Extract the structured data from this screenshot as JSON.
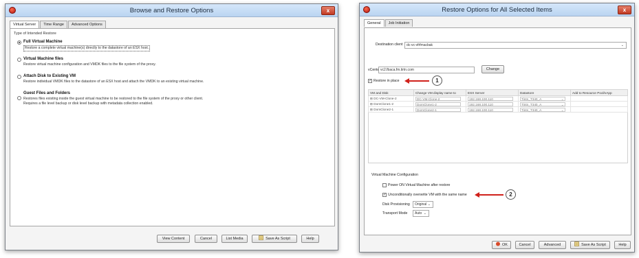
{
  "browse_window": {
    "title": "Browse and Restore Options",
    "close_label": "x",
    "tabs": [
      "Virtual Server",
      "Time Range",
      "Advanced Options"
    ],
    "section_label": "Type of Intended Restore",
    "options": [
      {
        "title": "Full Virtual Machine",
        "desc": "Restore a complete virtual machine(s) directly to the datastore of an ESX host.",
        "selected": true
      },
      {
        "title": "Virtual Machine files",
        "desc": "Restore virtual machine configuration and VMDK files to the file system of the proxy.",
        "selected": false
      },
      {
        "title": "Attach Disk to Existing VM",
        "desc": "Restore individual VMDK files to the datastore of an ESX host and attach the VMDK to an existing virtual machine.",
        "selected": false
      },
      {
        "title": "Guest Files and Folders",
        "desc": "Restores files existing inside the guest virtual machine to be restored to the file system of the proxy or other client.",
        "desc2": "Requires a file level backup or disk level backup with metadata collection enabled.",
        "selected": false
      }
    ],
    "buttons": {
      "view_content": "View Content",
      "cancel": "Cancel",
      "list_media": "List Media",
      "save_as_script": "Save As Script",
      "help": "Help"
    }
  },
  "restore_window": {
    "title": "Restore Options for All Selected Items",
    "close_label": "x",
    "tabs": [
      "General",
      "Job Initiation"
    ],
    "destination_client_label": "Destination client",
    "destination_client_value": "dc-vc-vfrfmacbak",
    "vcenter_label": "vCenter",
    "vcenter_value": "vc2.fbaca.fm.tirtn.com",
    "change_label": "Change",
    "restore_in_place_label": "Restore in place",
    "restore_in_place_checked": true,
    "callout_1": "1",
    "callout_2": "2",
    "table": {
      "columns": [
        "VM and Disk",
        "Change VM display name to",
        "ESX Server",
        "Datastore",
        "Add to Resource Pool/vApp"
      ],
      "rows": [
        {
          "vm": "DC-VM-Clone-2",
          "name": "DC-VM-Clone-2",
          "esx": "192.168.100.110",
          "datastore": "Tintn_T340_A"
        },
        {
          "vm": "DomClone1-2",
          "name": "DomClone1-2",
          "esx": "192.168.100.110",
          "datastore": "Tintn_T340_A"
        },
        {
          "vm": "DomClone2-1",
          "name": "DomClone2-1",
          "esx": "192.168.100.110",
          "datastore": "Tintn_T340_A"
        }
      ]
    },
    "vm_config_label": "Virtual Machine Configuration",
    "power_on_label": "Power ON Virtual Machine after restore",
    "power_on_checked": false,
    "overwrite_label": "Unconditionally overwrite VM with the same name",
    "overwrite_checked": true,
    "disk_provisioning_label": "Disk Provisioning",
    "disk_provisioning_value": "Original",
    "transport_mode_label": "Transport Mode",
    "transport_mode_value": "Auto",
    "buttons": {
      "ok": "OK",
      "cancel": "Cancel",
      "advanced": "Advanced",
      "save_as_script": "Save As Script",
      "help": "Help"
    }
  },
  "colors": {
    "accent_red": "#d0201a",
    "titlebar": "#c6dcf5"
  }
}
